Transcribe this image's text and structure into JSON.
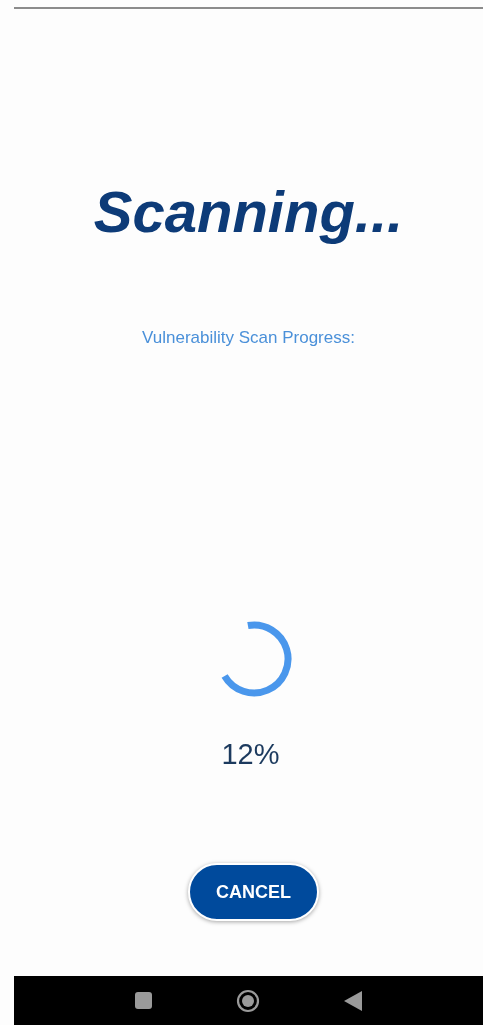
{
  "title": "Scanning...",
  "subtitle": "Vulnerability Scan Progress:",
  "progress_text": "12%",
  "buttons": [
    {
      "label": "CANCEL",
      "kind": "primary"
    }
  ]
}
